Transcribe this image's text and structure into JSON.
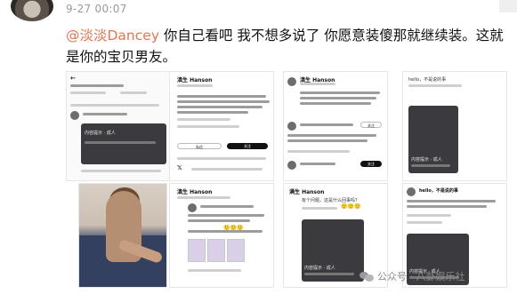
{
  "header": {
    "timestamp": "9-27 00:07"
  },
  "post": {
    "mention": "@淡淡Dancey",
    "text": " 你自己看吧 我不想多说了 你愿意装傻那就继续装。这就是你的宝贝男友。"
  },
  "screenshots": {
    "c2_name": "滇生 Hanson",
    "c3_name": "滇生 Hanson",
    "c6_name": "滇生 Hanson",
    "c7_name": "满生 Hanson",
    "c4_title": "hello，不是说的事",
    "c8_title": "hello，不是说的事",
    "dark_label": "内容提示 · 成人",
    "follow_label": "关注",
    "message_label": "私信",
    "count_label": "99+",
    "c7_question": "有个问题，这是什么回事吗？",
    "c6_emoji_text": "🙂🙂🙂",
    "c4_footer": "内容提示 · 成人"
  },
  "watermark": {
    "text": "公众号 · 八卦娱乐社"
  },
  "colors": {
    "mention": "#eb7350",
    "timestamp": "#9a9a9a",
    "dark_panel": "#3b3b3f"
  }
}
